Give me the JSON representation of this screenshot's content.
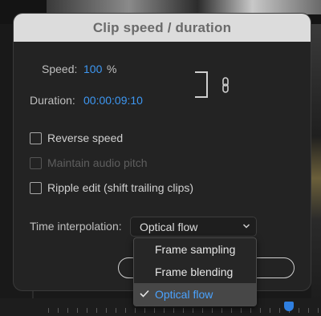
{
  "dialog": {
    "title": "Clip speed / duration",
    "speed_label": "Speed:",
    "speed_value": "100",
    "speed_unit": "%",
    "duration_label": "Duration:",
    "duration_value": "00:00:09:10"
  },
  "options": {
    "reverse_speed": {
      "label": "Reverse speed",
      "checked": false,
      "enabled": true
    },
    "maintain_pitch": {
      "label": "Maintain audio pitch",
      "checked": false,
      "enabled": false
    },
    "ripple_edit": {
      "label": "Ripple edit (shift trailing clips)",
      "checked": false,
      "enabled": true
    }
  },
  "interpolation": {
    "label": "Time interpolation:",
    "selected": "Optical flow",
    "items": [
      "Frame sampling",
      "Frame blending",
      "Optical flow"
    ]
  },
  "colors": {
    "accent": "#3d97f2",
    "title_bar": "#dcdcdc",
    "dialog_bg": "#232323"
  }
}
